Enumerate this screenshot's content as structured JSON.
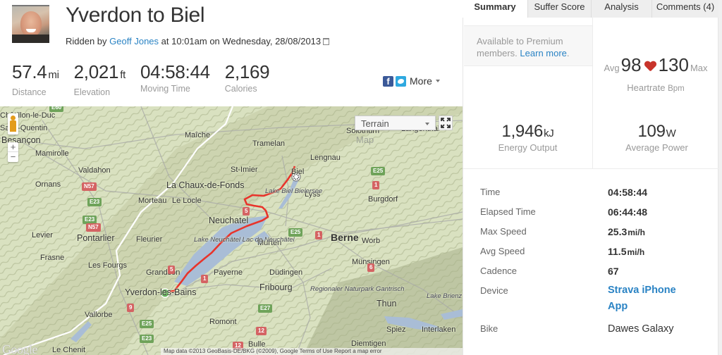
{
  "activity": {
    "title": "Yverdon to Biel",
    "ridden_by_prefix": "Ridden by",
    "athlete": "Geoff Jones",
    "time_text": "at 10:01am on Wednesday, 28/08/2013"
  },
  "stats": [
    {
      "value": "57.4",
      "unit": "mi",
      "label": "Distance"
    },
    {
      "value": "2,021",
      "unit": "ft",
      "label": "Elevation"
    },
    {
      "value": "04:58:44",
      "unit": "",
      "label": "Moving Time"
    },
    {
      "value": "2,169",
      "unit": "",
      "label": "Calories"
    }
  ],
  "share": {
    "more_label": "More",
    "facebook_icon": "facebook-icon",
    "twitter_icon": "twitter-icon"
  },
  "tabs": [
    {
      "label": "Summary",
      "active": true
    },
    {
      "label": "Suffer Score",
      "active": false
    },
    {
      "label": "Analysis",
      "active": false
    },
    {
      "label": "Comments (4)",
      "active": false
    }
  ],
  "premium": {
    "text": "Available to Premium members.",
    "link": "Learn more",
    "suffix": "."
  },
  "heartrate": {
    "avg_label": "Avg",
    "avg": "98",
    "max": "130",
    "max_label": "Max",
    "label": "Heartrate",
    "unit": "Bpm"
  },
  "energy": {
    "value": "1,946",
    "unit": "kJ",
    "label": "Energy Output"
  },
  "power": {
    "value": "109",
    "unit": "W",
    "label": "Average Power"
  },
  "details": [
    {
      "key": "Time",
      "value": "04:58:44",
      "unit": ""
    },
    {
      "key": "Elapsed Time",
      "value": "06:44:48",
      "unit": ""
    },
    {
      "key": "Max Speed",
      "value": "25.3",
      "unit": "mi/h"
    },
    {
      "key": "Avg Speed",
      "value": "11.5",
      "unit": "mi/h"
    },
    {
      "key": "Cadence",
      "value": "67",
      "unit": ""
    },
    {
      "key": "Device",
      "value": "Strava iPhone App",
      "unit": ""
    },
    {
      "key": "Bike",
      "value": "Dawes Galaxy",
      "unit": ""
    }
  ],
  "map": {
    "type_selected": "Terrain",
    "type_ghost": "Map",
    "google": "Google",
    "attribution": "Map data ©2013 GeoBasis-DE/BKG (©2009), Google  Terms of Use  Report a map error",
    "zoom_in": "+",
    "zoom_out": "−",
    "route_color": "#e8342b",
    "start_color": "#3fa63a",
    "places": [
      "Châtillon-le-Duc",
      "Saint-Quentin",
      "Besançon",
      "Mamirolle",
      "Valdahon",
      "Ornans",
      "Maîche",
      "La Chaux-de-Fonds",
      "Morteau",
      "Le Locle",
      "Tramelan",
      "St-Imier",
      "Lengnau",
      "Solothurn",
      "Langenthal",
      "Biel",
      "Lyss",
      "Burgdorf",
      "Neuchatel",
      "Murten",
      "Berne",
      "Worb",
      "Levier",
      "Pontarlier",
      "Fleurier",
      "Frasne",
      "Les Fourgs",
      "Grandson",
      "Yverdon-les-Bains",
      "Payerne",
      "Düdingen",
      "Fribourg",
      "Münsingen",
      "Vallorbe",
      "Romont",
      "Thun",
      "Spiez",
      "Interlaken",
      "Bulle",
      "Diemtigen",
      "Le Chenit"
    ],
    "lakes": [
      "Lake Biel Bielersee",
      "Lake Neuchâtel Lac de Neuchâtel",
      "Lake Brienz Brienzersee"
    ],
    "park": "Regionaler Naturpark Gantrisch",
    "shields": [
      "E60",
      "N57",
      "E23",
      "E23",
      "N57",
      "E25",
      "1",
      "5",
      "5",
      "1",
      "E25",
      "1",
      "6",
      "E27",
      "12",
      "12",
      "9",
      "E25",
      "E23"
    ]
  }
}
